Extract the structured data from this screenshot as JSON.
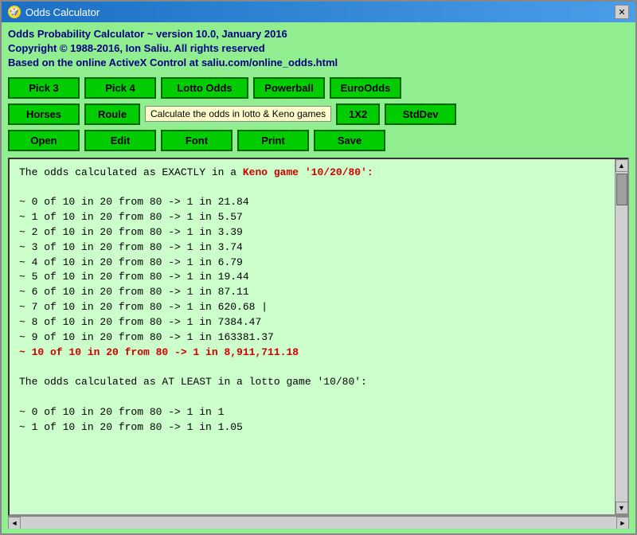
{
  "window": {
    "title": "Odds Calculator",
    "icon": "🎲"
  },
  "header": {
    "line1": "Odds Probability Calculator ~ version 10.0, January 2016",
    "line2": "Copyright © 1988-2016, Ion Saliu. All rights reserved",
    "line3": "Based on the online ActiveX Control at saliu.com/online_odds.html"
  },
  "buttons_row1": {
    "pick3": "Pick 3",
    "pick4": "Pick 4",
    "lotto_odds": "Lotto Odds",
    "powerball": "Powerball",
    "euro_odds": "EuroOdds"
  },
  "buttons_row2": {
    "horses": "Horses",
    "roulette": "Roule",
    "tooltip": "Calculate the odds in lotto & Keno games",
    "onex2": "1X2",
    "stddev": "StdDev"
  },
  "buttons_row3": {
    "open": "Open",
    "edit": "Edit",
    "font": "Font",
    "print": "Print",
    "save": "Save"
  },
  "output": {
    "lines": [
      {
        "text": "The odds calculated as EXACTLY in a ",
        "type": "mixed",
        "red": "Keno game '10/20/80':"
      },
      {
        "text": "",
        "type": "blank"
      },
      {
        "text": "~ 0 of 10 in 20 from 80   ->  1 in 21.84",
        "type": "normal"
      },
      {
        "text": "~ 1 of 10 in 20 from 80   ->  1 in 5.57",
        "type": "normal"
      },
      {
        "text": "~ 2 of 10 in 20 from 80   ->  1 in 3.39",
        "type": "normal"
      },
      {
        "text": "~ 3 of 10 in 20 from 80   ->  1 in 3.74",
        "type": "normal"
      },
      {
        "text": "~ 4 of 10 in 20 from 80   ->  1 in 6.79",
        "type": "normal"
      },
      {
        "text": "~ 5 of 10 in 20 from 80   ->  1 in 19.44",
        "type": "normal"
      },
      {
        "text": "~ 6 of 10 in 20 from 80   ->  1 in 87.11",
        "type": "normal"
      },
      {
        "text": "~ 7 of 10 in 20 from 80   ->  1 in 620.68",
        "type": "cursor"
      },
      {
        "text": "~ 8 of 10 in 20 from 80   ->  1 in 7384.47",
        "type": "normal"
      },
      {
        "text": "~ 9 of 10 in 20 from 80   ->  1 in 163381.37",
        "type": "normal"
      },
      {
        "text": "~ 10 of 10 in 20 from 80  ->  1 in 8,911,711.18",
        "type": "red"
      },
      {
        "text": "",
        "type": "blank"
      },
      {
        "text": "The odds calculated as AT LEAST in a lotto game '10/80':",
        "type": "normal"
      },
      {
        "text": "",
        "type": "blank"
      },
      {
        "text": "~ 0 of 10 in 20 from 80   ->  1 in 1",
        "type": "normal"
      },
      {
        "text": "~ 1 of 10 in 20 from 80   ->  1 in 1.05",
        "type": "normal"
      }
    ]
  },
  "icons": {
    "close": "✕",
    "scroll_up": "▲",
    "scroll_down": "▼",
    "scroll_left": "◄",
    "scroll_right": "►"
  }
}
